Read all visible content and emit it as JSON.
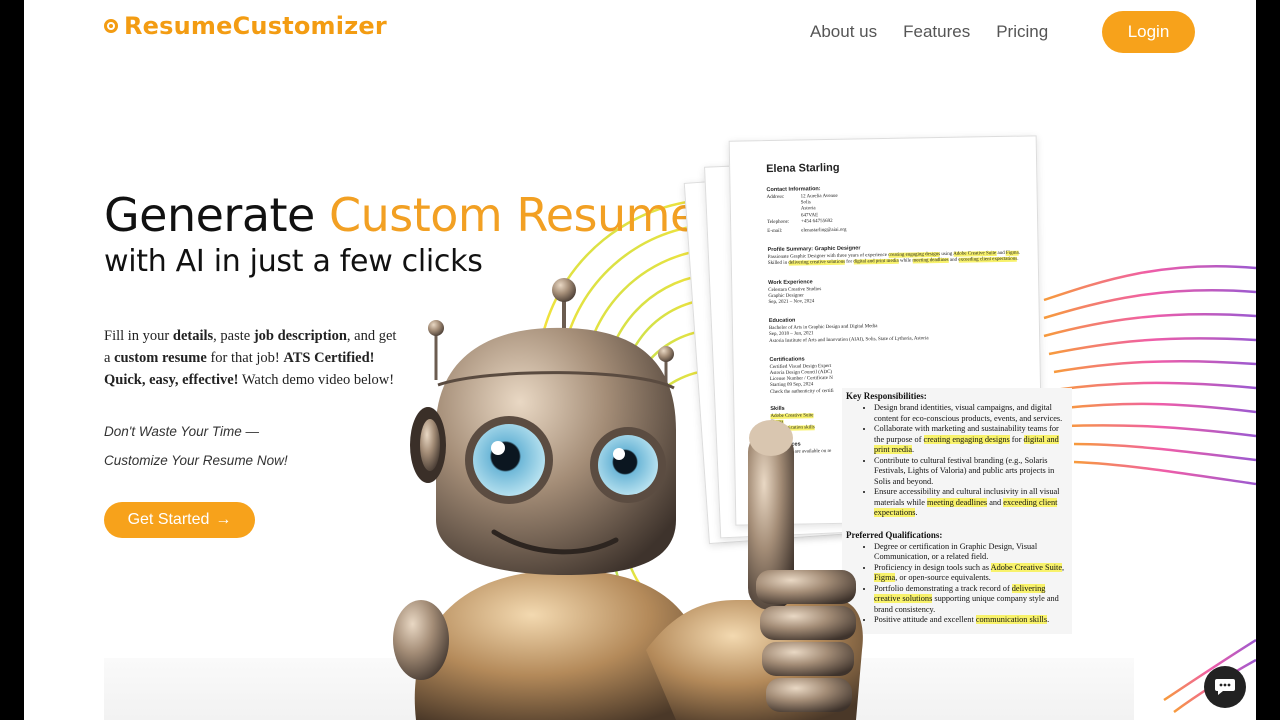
{
  "brand": {
    "name": "ResumeCustomizer",
    "color": "#f39c12"
  },
  "nav": {
    "items": [
      "About us",
      "Features",
      "Pricing"
    ],
    "login": "Login"
  },
  "hero": {
    "title_plain": "Generate ",
    "title_accent": "Custom Resume",
    "subtitle": "with AI in just a few clicks",
    "desc": {
      "p1": "Fill in your ",
      "b1": "details",
      "p2": ", paste ",
      "b2": "job description",
      "p3": ", and get a ",
      "b3": "custom resume",
      "p4": " for that job! ",
      "b4": "ATS Certified! Quick, easy, effective!",
      "p5": " Watch demo video below!"
    },
    "tagline1": "Don't Waste Your Time —",
    "tagline2": "Customize Your Resume Now!",
    "cta": "Get Started",
    "cta_arrow": "→"
  },
  "resume": {
    "name": "Elena Starling",
    "contact_title": "Contact Information:",
    "address_label": "Address:",
    "address_lines": [
      "12 Aurelia Avenue",
      "Solis",
      "Astoria",
      "647VAE"
    ],
    "phone_label": "Telephone:",
    "phone": "+454 64755692",
    "email_label": "E-mail:",
    "email": "elenastarling@aiai.org",
    "profile_title": "Profile Summary: Graphic Designer",
    "profile_1": "Passionate Graphic Designer with three years of experience ",
    "profile_hl1": "creating engaging designs",
    "profile_2": " using ",
    "profile_hl2": "Adobe Creative Suite",
    "profile_3": " and ",
    "profile_hl3": "Figma",
    "profile_4": ". Skilled in ",
    "profile_hl4": "delivering creative solutions",
    "profile_5": " for ",
    "profile_hl5": "digital and print media",
    "profile_6": " while ",
    "profile_hl6": "meeting deadlines",
    "profile_7": " and ",
    "profile_hl7": "exceeding client expectations",
    "profile_8": ".",
    "work_title": "Work Experience",
    "work_lines": [
      "Celestara Creative Studios",
      "Graphic Designer",
      "Sep, 2021 – Nov, 2024"
    ],
    "edu_title": "Education",
    "edu_lines": [
      "Bachelor of Arts in Graphic Design and Digital Media",
      "Sep, 2018 – Jun, 2021",
      "Astoria Institute of Arts and Innovation (AIAI), Solis, State of Lythoria, Astoria"
    ],
    "cert_title": "Certifications",
    "cert_lines": [
      "Certified Visual Design Expert",
      "Astoria Design Council (ADC)",
      "License Number / Certificate N",
      "Starting 09 Sep, 2024",
      "Check the authenticity of certifi"
    ],
    "skills_title": "Skills",
    "skills": [
      "Adobe Creative Suite",
      "Figma",
      "Communication skills"
    ],
    "ref_title": "References",
    "ref_line": "References are available on re"
  },
  "job": {
    "resp_title": "Key Responsibilities:",
    "resp": [
      [
        "Design brand identities, visual campaigns, and digital content for eco-conscious products, events, and services.",
        "",
        ""
      ],
      [
        "Collaborate with marketing and sustainability teams for the purpose of ",
        "creating engaging designs",
        " for "
      ],
      [
        "Contribute to cultural festival branding (e.g., Solaris Festivals, Lights of Valoria) and public arts projects in Solis and beyond.",
        "",
        ""
      ],
      [
        "Ensure accessibility and cultural inclusivity in all visual materials while ",
        "meeting deadlines",
        " and "
      ]
    ],
    "resp2_hl": "digital and print media",
    "resp2_end": ".",
    "resp4_hl": "exceeding client expectations",
    "resp4_end": ".",
    "qual_title": "Preferred Qualifications:",
    "q1": "Degree or certification in Graphic Design, Visual Communication, or a related field.",
    "q2a": "Proficiency in design tools such as ",
    "q2hl1": "Adobe Creative Suite",
    "q2b": ", ",
    "q2hl2": "Figma",
    "q2c": ", or open-source equivalents.",
    "q3a": "Portfolio demonstrating a track record of ",
    "q3hl": "delivering creative solutions",
    "q3b": " supporting unique company style and brand consistency.",
    "q4a": "Positive attitude and excellent ",
    "q4hl": "communication skills",
    "q4b": "."
  },
  "icons": {
    "chat": "chat-icon",
    "logo": "target-icon"
  }
}
